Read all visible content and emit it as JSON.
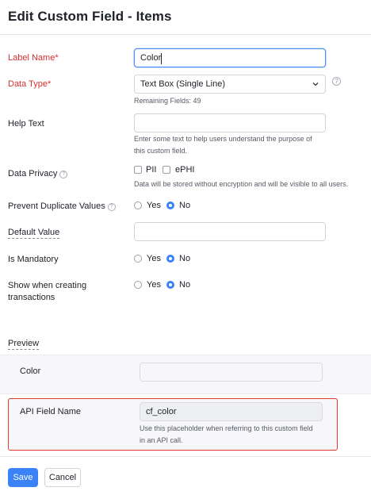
{
  "page": {
    "title": "Edit Custom Field - Items"
  },
  "form": {
    "label_name": {
      "label": "Label Name*",
      "value": "Color"
    },
    "data_type": {
      "label": "Data Type*",
      "selected": "Text Box (Single Line)",
      "remaining": "Remaining Fields: 49"
    },
    "help_text": {
      "label": "Help Text",
      "value": "",
      "hint_line1": "Enter some text to help users understand the purpose of",
      "hint_line2": "this custom field."
    },
    "data_privacy": {
      "label": "Data Privacy",
      "opt_pii": "PII",
      "opt_ephi": "ePHI",
      "note": "Data will be stored without encryption and will be visible to all users."
    },
    "prevent_duplicates": {
      "label": "Prevent Duplicate Values",
      "yes": "Yes",
      "no": "No",
      "selected": "No"
    },
    "default_value": {
      "label": "Default Value",
      "value": ""
    },
    "is_mandatory": {
      "label": "Is Mandatory",
      "yes": "Yes",
      "no": "No",
      "selected": "No"
    },
    "show_when_creating": {
      "label_line1": "Show when creating",
      "label_line2": "transactions",
      "yes": "Yes",
      "no": "No",
      "selected": "No"
    }
  },
  "preview": {
    "heading": "Preview",
    "field_label": "Color",
    "field_value": ""
  },
  "api": {
    "label": "API Field Name",
    "value": "cf_color",
    "hint_line1": "Use this placeholder when referring to this custom field",
    "hint_line2": "in an API call.",
    "highlight_color": "#e0392b"
  },
  "actions": {
    "save": "Save",
    "cancel": "Cancel"
  },
  "colors": {
    "accent": "#3b82f6",
    "required": "#d6312f"
  }
}
